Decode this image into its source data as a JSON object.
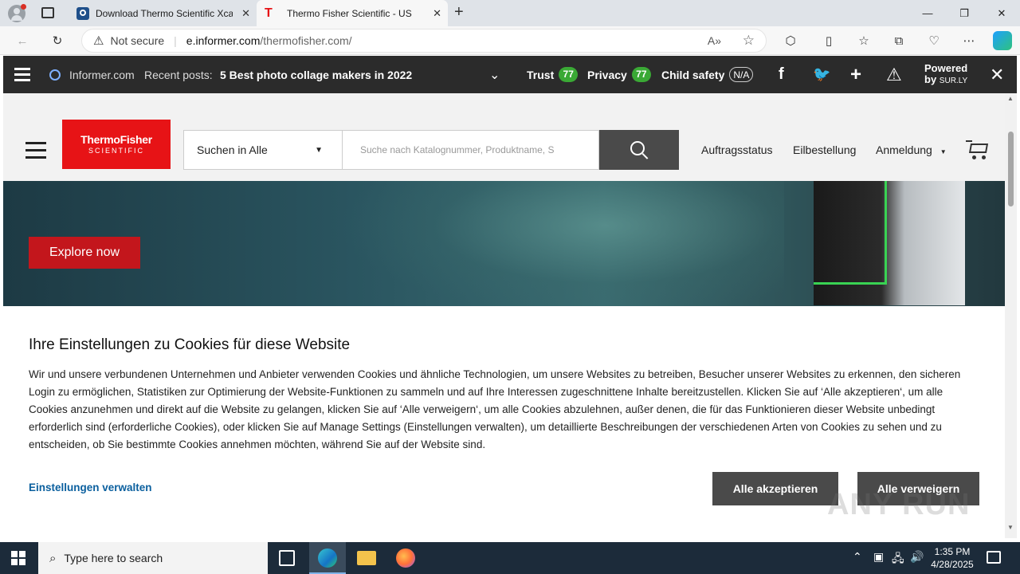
{
  "tabs": [
    {
      "title": "Download Thermo Scientific Xcal",
      "active": false
    },
    {
      "title": "Thermo Fisher Scientific - US",
      "active": true
    }
  ],
  "address": {
    "security": "Not secure",
    "url_host": "e.informer.com",
    "url_path": "/thermofisher.com/"
  },
  "informer": {
    "site": "Informer.com",
    "recent_label": "Recent posts:",
    "recent_post": "5 Best photo collage makers in 2022",
    "trust_label": "Trust",
    "trust_score": "77",
    "privacy_label": "Privacy",
    "privacy_score": "77",
    "child_label": "Child safety",
    "child_score": "N/A",
    "powered_line1": "Powered",
    "powered_line2_prefix": "by",
    "powered_line2_brand": "SUR.LY"
  },
  "site": {
    "logo_line1": "ThermoFisher",
    "logo_line2": "SCIENTIFIC",
    "search_scope": "Suchen in Alle",
    "search_placeholder": "Suche nach Katalognummer, Produktname, S",
    "nav": [
      "Auftragsstatus",
      "Eilbestellung",
      "Anmeldung"
    ],
    "hero_button": "Explore now"
  },
  "cookie": {
    "title": "Ihre Einstellungen zu Cookies für diese Website",
    "body": "Wir und unsere verbundenen Unternehmen und Anbieter verwenden Cookies und ähnliche Technologien, um unsere Websites zu betreiben, Besucher unserer Websites zu erkennen, den sicheren Login zu ermöglichen, Statistiken zur Optimierung der Website-Funktionen zu sammeln und auf Ihre Interessen zugeschnittene Inhalte bereitzustellen. Klicken Sie auf ‘Alle akzeptieren‘, um alle Cookies anzunehmen und direkt auf die Website zu gelangen, klicken Sie auf ‘Alle verweigern‘, um alle Cookies abzulehnen, außer denen, die für das Funktionieren dieser Website unbedingt erforderlich sind (erforderliche Cookies), oder klicken Sie auf Manage Settings (Einstellungen verwalten), um detaillierte Beschreibungen der verschiedenen Arten von Cookies zu sehen und zu entscheiden, ob Sie bestimmte Cookies annehmen möchten, während Sie auf der Website sind.",
    "manage_link": "Einstellungen verwalten",
    "accept_all": "Alle akzeptieren",
    "reject_all": "Alle verweigern"
  },
  "taskbar": {
    "search_placeholder": "Type here to search",
    "time": "1:35 PM",
    "date": "4/28/2025"
  },
  "watermark": "ANY RUN",
  "colors": {
    "brand_red": "#e71316",
    "hero_button": "#c3161c",
    "score_green": "#3aa935",
    "dark_button": "#4a4a4a",
    "link_blue": "#0a5f9e"
  }
}
